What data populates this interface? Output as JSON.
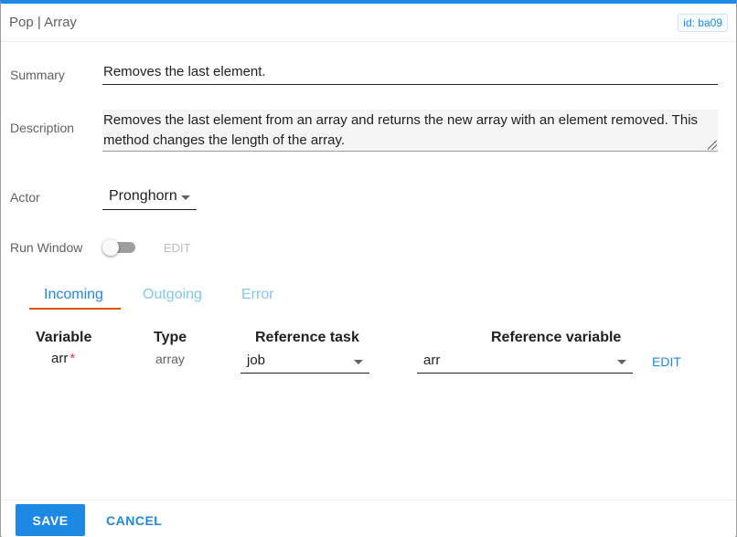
{
  "window": {
    "title": "Pop | Array",
    "id_badge": "id: ba09"
  },
  "form": {
    "summary_label": "Summary",
    "summary_value": "Removes the last element.",
    "description_label": "Description",
    "description_value": "Removes the last element from an array and returns the new array with an element removed. This method changes the length of the array.",
    "actor_label": "Actor",
    "actor_value": "Pronghorn",
    "run_window_label": "Run Window",
    "run_window_enabled": false,
    "run_window_edit": "EDIT"
  },
  "tabs": [
    {
      "label": "Incoming",
      "active": true
    },
    {
      "label": "Outgoing",
      "active": false
    },
    {
      "label": "Error",
      "active": false
    }
  ],
  "variables_table": {
    "headers": {
      "variable": "Variable",
      "type": "Type",
      "reference_task": "Reference task",
      "reference_variable": "Reference variable"
    },
    "rows": [
      {
        "variable": "arr",
        "required_marker": "*",
        "type": "array",
        "reference_task": "job",
        "reference_variable": "arr",
        "edit_label": "EDIT"
      }
    ]
  },
  "footer": {
    "save_label": "SAVE",
    "cancel_label": "CANCEL"
  },
  "colors": {
    "accent": "#1e88e5",
    "tab_indicator": "#e65100",
    "required": "#e53935"
  },
  "icons": [
    "dropdown-caret-icon",
    "resize-grip-icon"
  ]
}
